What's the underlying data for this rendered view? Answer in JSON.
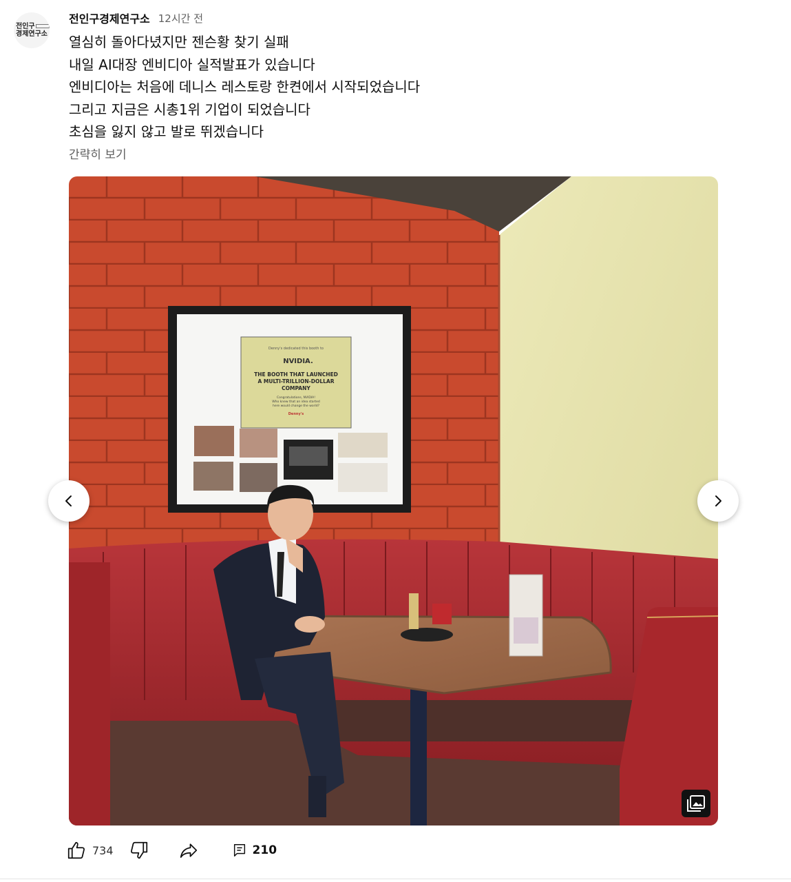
{
  "channel": {
    "avatar_line1": "전인구",
    "avatar_line2": "경제연구소",
    "name": "전인구경제연구소",
    "timestamp": "12시간 전"
  },
  "post": {
    "lines": [
      "열심히 돌아다녔지만 젠슨황 찾기 실패",
      "내일 AI대장 엔비디아 실적발표가 있습니다",
      "엔비디아는 처음에 데니스 레스토랑 한켠에서 시작되었습니다",
      "그리고 지금은 시총1위 기업이 되었습니다",
      "초심을 잃지 않고 발로 뛰겠습니다"
    ],
    "show_less": "간략히 보기"
  },
  "photo": {
    "sign_small_text": "Denny's dedicated this booth to",
    "sign_brand": "NVIDIA.",
    "sign_headline": [
      "THE BOOTH THAT LAUNCHED",
      "A MULTI-TRILLION-DOLLAR",
      "COMPANY"
    ],
    "sign_sub": [
      "Congratulations, NVIDIA!",
      "Who knew that an idea started",
      "here would change the world?"
    ],
    "sign_logo": "Denny's"
  },
  "icons": {
    "prev": "chevron-left-icon",
    "next": "chevron-right-icon",
    "gallery": "image-gallery-icon",
    "like": "thumbs-up-icon",
    "dislike": "thumbs-down-icon",
    "share": "share-icon",
    "comment": "comment-icon"
  },
  "actions": {
    "like_count": "734",
    "comment_count": "210"
  },
  "colors": {
    "brick": "#c94a2e",
    "wall": "#e8e6b2",
    "booth": "#a52a2c",
    "table": "#9a6a4a"
  }
}
